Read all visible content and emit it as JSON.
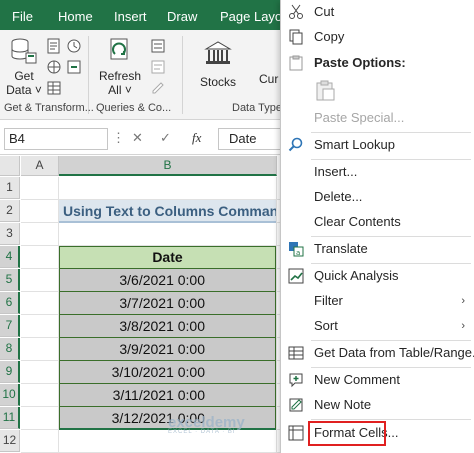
{
  "ribbon": {
    "tabs": [
      "File",
      "Home",
      "Insert",
      "Draw",
      "Page Layou"
    ],
    "buttons": {
      "get_data_line1": "Get",
      "get_data_line2": "Data ˅",
      "refresh_line1": "Refresh",
      "refresh_line2": "All ˅",
      "stocks": "Stocks",
      "currencies_partial": "Cur"
    },
    "groups": [
      "Get & Transform...",
      "Queries & Co...",
      "Data Type"
    ]
  },
  "formula_bar": {
    "name_box": "B4",
    "cancel": "✕",
    "enter": "✓",
    "fx": "fx",
    "value": "Date"
  },
  "grid": {
    "columns": [
      "A",
      "B"
    ],
    "rows": [
      "1",
      "2",
      "3",
      "4",
      "5",
      "6",
      "7",
      "8",
      "9",
      "10",
      "11",
      "12"
    ],
    "title": "Using Text to Columns Command",
    "header": "Date",
    "dates": [
      "3/6/2021 0:00",
      "3/7/2021 0:00",
      "3/8/2021 0:00",
      "3/9/2021 0:00",
      "3/10/2021 0:00",
      "3/11/2021 0:00",
      "3/12/2021 0:00"
    ]
  },
  "watermark": {
    "name": "exceldemy",
    "tagline": "EXCEL · DATA · BI"
  },
  "context_menu": {
    "cut": "Cut",
    "copy": "Copy",
    "paste_options": "Paste Options:",
    "paste_special": "Paste Special...",
    "smart_lookup": "Smart Lookup",
    "insert": "Insert...",
    "delete": "Delete...",
    "clear_contents": "Clear Contents",
    "translate": "Translate",
    "quick_analysis": "Quick Analysis",
    "filter": "Filter",
    "sort": "Sort",
    "get_data_table": "Get Data from Table/Range...",
    "new_comment": "New Comment",
    "new_note": "New Note",
    "format_cells": "Format Cells...",
    "submenu_arrow": "›"
  },
  "colors": {
    "excel_green": "#217346",
    "highlight_red": "#e02020",
    "header_fill": "#c6e0b4",
    "row_fill": "#c9c9c9"
  }
}
